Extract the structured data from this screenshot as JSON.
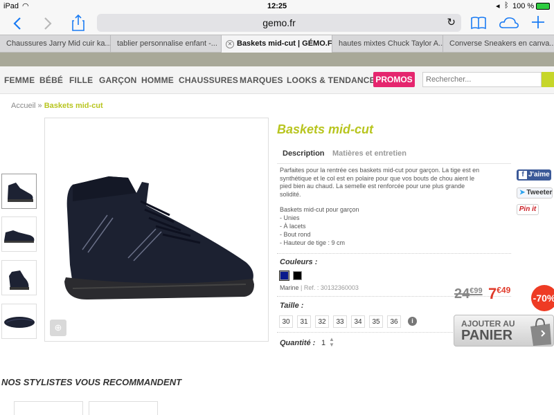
{
  "status_bar": {
    "device": "iPad",
    "time": "12:25",
    "battery": "100 %"
  },
  "browser": {
    "url": "gemo.fr"
  },
  "tabs": [
    {
      "label": "Chaussures Jarry Mid cuir ka..."
    },
    {
      "label": "tablier personnalise enfant -..."
    },
    {
      "label": "Baskets mid-cut | GÉMO.FR"
    },
    {
      "label": "hautes mixtes Chuck Taylor A..."
    },
    {
      "label": "Converse Sneakers en canva..."
    }
  ],
  "nav": {
    "items": [
      "FEMME",
      "BÉBÉ",
      "FILLE",
      "GARÇON",
      "HOMME",
      "CHAUSSURES",
      "MARQUES",
      "LOOKS & TENDANCES"
    ],
    "promos": "PROMOS",
    "search_placeholder": "Rechercher..."
  },
  "breadcrumb": {
    "home": "Accueil",
    "sep": "»",
    "current": "Baskets mid-cut"
  },
  "product": {
    "title": "Baskets mid-cut",
    "tabs": [
      "Description",
      "Matières et entretien"
    ],
    "description": "Parfaites pour la rentrée ces baskets mid-cut pour garçon. La tige est en synthétique et le col est en polaire pour que vos bouts de chou aient le pied bien au chaud. La semelle est renforcée pour une plus grande solidité.",
    "details_title": "Baskets mid-cut pour garçon",
    "details": [
      "- Unies",
      "- À lacets",
      "- Bout rond",
      "- Hauteur de tige : 9 cm"
    ],
    "colors_label": "Couleurs :",
    "colors": [
      "#0a1a8c",
      "#000000"
    ],
    "color_name": "Marine",
    "ref": "| Ref. : 30132360003",
    "size_label": "Taille :",
    "sizes": [
      "30",
      "31",
      "32",
      "33",
      "34",
      "35",
      "36"
    ],
    "qty_label": "Quantité :",
    "qty": "1",
    "old_price_int": "24",
    "old_price_dec": "€99",
    "new_price_int": "7",
    "new_price_dec": "€49",
    "discount": "-70%",
    "cart_line1": "AJOUTER AU",
    "cart_line2": "PANIER"
  },
  "social": {
    "facebook": "J'aime",
    "twitter": "Tweeter",
    "pinterest": "Pin it"
  },
  "recommend": {
    "title": "NOS STYLISTES VOUS RECOMMANDENT"
  }
}
